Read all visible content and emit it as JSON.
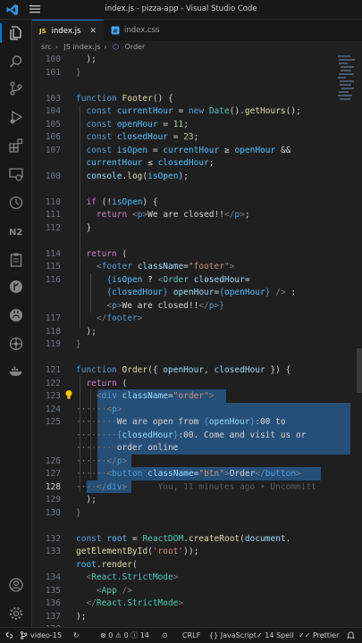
{
  "window": {
    "title": "index.js - pizza-app - Visual Studio Code"
  },
  "tabs": [
    {
      "label": "index.js",
      "lang": "JS",
      "active": true
    },
    {
      "label": "index.css"
    }
  ],
  "breadcrumb": [
    "src",
    "JS index.js",
    "Order"
  ],
  "line_numbers": [
    "100",
    "101",
    "",
    "103",
    "104",
    "105",
    "106",
    "107",
    "",
    "108",
    "",
    "110",
    "111",
    "112",
    "",
    "114",
    "115",
    "116",
    "",
    "",
    "117",
    "118",
    "119",
    "",
    "121",
    "122",
    "123",
    "124",
    "125",
    "",
    "",
    "126",
    "127",
    "128",
    "129",
    "130",
    "",
    "132",
    "133",
    "",
    "134",
    "135",
    "136",
    "137",
    "138"
  ],
  "current_line": "128",
  "blame": "You, 11 minutes ago • Uncommitt",
  "statusbar": {
    "branch": "video-15",
    "problems": "0",
    "warnings": "0",
    "info": "14",
    "eol": "CRLF",
    "language": "JavaScript",
    "spell": "14 Spell",
    "formatter": "Prettier"
  }
}
